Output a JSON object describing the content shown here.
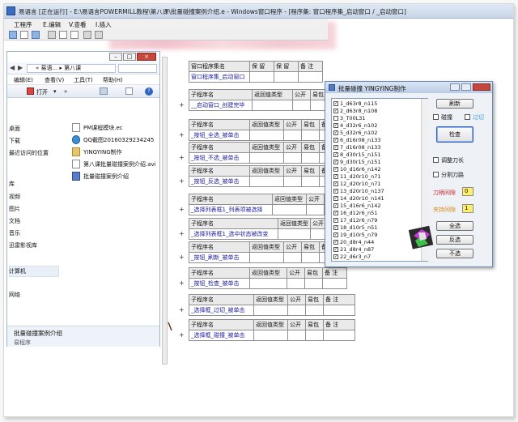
{
  "window": {
    "title": "易语言 [正在运行] - E:\\易语言POWERMILL教程\\第八课\\批量碰撞案例介绍.e - Windows窗口程序 - [程序集: 窗口程序集_启动窗口 / _启动窗口]"
  },
  "menubar": {
    "items": [
      "工程序",
      "E.编辑",
      "V.查看",
      "I.插入"
    ]
  },
  "explorer": {
    "breadcrumb": "« 易语... ▸ 第八课",
    "menu": [
      "编辑(E)",
      "查看(V)",
      "工具(T)",
      "帮助(H)"
    ],
    "toolbar": {
      "open": "打开",
      "more": "»"
    },
    "nav": [
      "桌面",
      "下载",
      "最近访问的位置",
      "库",
      "视频",
      "图片",
      "文档",
      "音乐",
      "迅雷影视库",
      "计算机",
      "网络"
    ],
    "files": [
      {
        "name": "PM课程模块.ec",
        "icon": "document-icon"
      },
      {
        "name": "QQ截图20160329234245",
        "icon": "qq-image-icon"
      },
      {
        "name": "YINGYING制作",
        "icon": "folder-icon"
      },
      {
        "name": "第八课批量碰撞案例介绍.avi",
        "icon": "document-icon"
      },
      {
        "name": "批量碰撞案例介绍",
        "icon": "exe-icon"
      }
    ],
    "status": {
      "name": "批量碰撞案例介绍",
      "type": "易程序"
    }
  },
  "code": {
    "top_table": {
      "headers": [
        "窗口程序集名",
        "保 留",
        "保 留",
        "备 注"
      ],
      "row": [
        "窗口程序集_启动窗口",
        "",
        "",
        ""
      ]
    },
    "sub_headers": [
      "子程序名",
      "返回值类型",
      "公开",
      "易包",
      "备 注"
    ],
    "subs": [
      "__启动窗口_创建完毕",
      "_按钮_全选_被单击",
      "_按钮_不选_被单击",
      "_按钮_反选_被单击",
      "_选择列表框1_列表项被选择",
      "_选择列表框1_选中状态被改变",
      "_按钮_刷新_被单击",
      "_按钮_检查_被单击",
      "_选择框_过切_被单击",
      "_选择框_碰撞_被单击"
    ],
    "marker": "+"
  },
  "dialog": {
    "title": "批量碰撞 YINGYING制作",
    "list_items": [
      "1_d63r8_n115",
      "2_d63r8_n108",
      "3_T00L31",
      "4_d32r6_n102",
      "5_d32r6_n102",
      "6_d16r08_n133",
      "7_d16r08_n133",
      "8_d30r15_n151",
      "9_d30r15_n151",
      "10_d16r6_n142",
      "11_d20r10_n71",
      "12_d20r10_n71",
      "13_d20r10_n137",
      "14_d20r10_n141",
      "15_d16r6_n142",
      "16_d12r6_n51",
      "17_d12r6_n79",
      "18_d10r5_n51",
      "19_d10r5_n79",
      "20_d8r4_n44",
      "21_d8r4_n87",
      "22_d6r3_n7"
    ],
    "refresh_label": "刷新",
    "collide_label": "碰撞",
    "overcut_label": "过切",
    "check_label": "检查",
    "adjust_label": "调整刀长",
    "split_label": "分割刀路",
    "blade_gap_label": "刀柄间隙",
    "blade_gap_value": "0",
    "holder_gap_label": "夹持间隙",
    "holder_gap_value": "1",
    "select_all_label": "全选",
    "invert_label": "反选",
    "none_label": "不选"
  }
}
